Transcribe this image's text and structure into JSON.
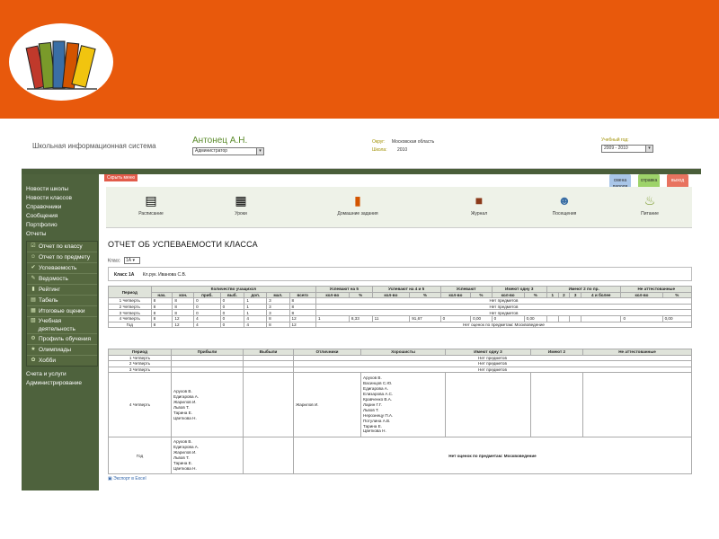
{
  "header": {
    "system_title": "Школьная информационная система",
    "user_name": "Антонец А.Н.",
    "role": "Администратор",
    "district_label": "Округ:",
    "district_value": "Московская область",
    "school_label": "Школа:",
    "school_value": "2010",
    "year_label": "Учебный год:",
    "year_value": "2009 - 2010"
  },
  "top_buttons": {
    "hide_menu": "Скрыть меню",
    "btn1": "смена пароля",
    "btn2": "справка",
    "btn3": "выход"
  },
  "sidebar": {
    "links_top": [
      "Новости школы",
      "Новости классов",
      "Справочники",
      "Сообщения",
      "Портфолио",
      "Отчеты"
    ],
    "reports": [
      {
        "icon": "☑",
        "label": "Отчет по классу"
      },
      {
        "icon": "☺",
        "label": "Отчет по предмету"
      },
      {
        "icon": "✔",
        "label": "Успеваемость"
      },
      {
        "icon": "✎",
        "label": "Ведомость"
      },
      {
        "icon": "▮",
        "label": "Рейтинг"
      },
      {
        "icon": "▤",
        "label": "Табель"
      },
      {
        "icon": "▦",
        "label": "Итоговые оценки"
      },
      {
        "icon": "▧",
        "label": "Учебная деятельность"
      },
      {
        "icon": "⚙",
        "label": "Профиль обучения"
      },
      {
        "icon": "★",
        "label": "Олимпиады"
      },
      {
        "icon": "✿",
        "label": "Хобби"
      }
    ],
    "links_bottom": [
      "Счета и услуги",
      "Администрирование"
    ]
  },
  "toolbar": [
    {
      "icon": "▤",
      "label": "Расписание"
    },
    {
      "icon": "▦",
      "label": "Уроки"
    },
    {
      "icon": "▮",
      "label": "Домашние задания"
    },
    {
      "icon": "■",
      "label": "Журнал"
    },
    {
      "icon": "☻",
      "label": "Посещения"
    },
    {
      "icon": "♨",
      "label": "Питание"
    }
  ],
  "page": {
    "title": "ОТЧЕТ ОБ УСПЕВАЕМОСТИ КЛАССА",
    "class_label": "Класс",
    "class_value": "1А",
    "info_class": "Класс 1А",
    "info_teacher": "Кл.рук. Иванова С.В.",
    "export_link": "Экспорт в Excel"
  },
  "table1": {
    "h_period": "Период",
    "h_count": "Количество учащихся",
    "h_count_sub": [
      "нач.",
      "кон.",
      "приб.",
      "выб.",
      "доп.",
      "мал.",
      "всего"
    ],
    "h_groups": [
      "Успевают на 5",
      "Успевают на 4 и 5",
      "Успевают",
      "Имеют одну 3",
      "Имеют 2 по пр.",
      "Не аттестованные"
    ],
    "h_sub_pair": [
      "кол-во",
      "%"
    ],
    "h_imeyut2_sub": [
      "1",
      "2",
      "3",
      "4 и более"
    ],
    "rows": [
      {
        "period": "1 Четверть",
        "counts": [
          "8",
          "8",
          "0",
          "0",
          "1",
          "3",
          "8"
        ],
        "note": "Нет предметов"
      },
      {
        "period": "2 Четверть",
        "counts": [
          "8",
          "8",
          "0",
          "0",
          "1",
          "3",
          "8"
        ],
        "note": "Нет предметов"
      },
      {
        "period": "3 Четверть",
        "counts": [
          "8",
          "8",
          "0",
          "0",
          "1",
          "3",
          "8"
        ],
        "note": "Нет предметов"
      },
      {
        "period": "4 Четверть",
        "counts": [
          "8",
          "12",
          "4",
          "0",
          "4",
          "8",
          "12"
        ],
        "vals": [
          "1",
          "8,33",
          "11",
          "91,67",
          "0",
          "0,00",
          "0",
          "0,00",
          "0",
          "0,00"
        ]
      },
      {
        "period": "Год",
        "counts": [
          "8",
          "12",
          "4",
          "0",
          "4",
          "8",
          "12"
        ],
        "note": "Нет оценок по предметам: Москвоведение"
      }
    ]
  },
  "table2": {
    "headers": [
      "Период",
      "Прибыли",
      "Выбыли",
      "Отличники",
      "Хорошисты",
      "Имеют одну 3",
      "Имеют 2",
      "Не аттестованные"
    ],
    "rows_simple": [
      {
        "period": "1 Четверть",
        "note": "Нет предметов"
      },
      {
        "period": "2 Четверть",
        "note": "Нет предметов"
      },
      {
        "period": "3 Четверть",
        "note": "Нет предметов"
      }
    ],
    "q4_period": "4 Четверть",
    "q4_arrived": "Арухов В.\nЕдигарова А.\nЖарилов И.\nЛьвов Т.\nТарина Е.\nЦветкова Н.",
    "q4_excellent": "Жарилов И.",
    "q4_good": "Арухов В.\nВасинцов С.Ю.\nЕдигарова А.\nЕлизарова А.С.\nКравченко В.А.\nЛарин Г.Г.\nЛьвов Т.\nНерознецу П.А.\nПотулина А.В.\nТарина Е.\nЦветкова Н.",
    "year_period": "Год",
    "year_arrived": "Арухов В.\nЕдигарова А.\nЖарилов И.\nЛьвов Т.\nТарина Е.\nЦветкова Н.",
    "year_note": "Нет оценок по предметам: Москвоведение"
  }
}
